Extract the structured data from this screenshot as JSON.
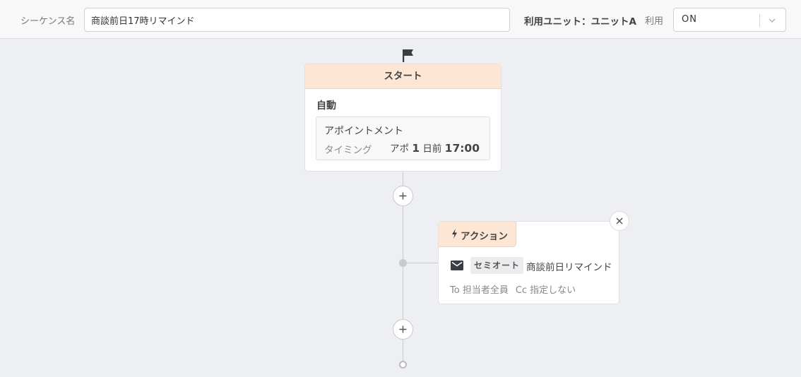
{
  "header": {
    "sequence_label": "シーケンス名",
    "sequence_name": "商談前日17時リマインド",
    "unit_text": "利用ユニット：ユニットA",
    "usage_label": "利用",
    "usage_value": "ON"
  },
  "start_node": {
    "header": "スタート",
    "mode": "自動",
    "trigger": {
      "title": "アポイントメント",
      "timing_label": "タイミング",
      "timing_prefix": "アポ",
      "timing_days": "1",
      "timing_days_unit": "日前",
      "timing_time": "17:00"
    }
  },
  "action_node": {
    "tab_label": "アクション",
    "sender": "セミオート",
    "template": "商談前日リマインド",
    "to": "To 担当者全員",
    "cc": "Cc 指定しない"
  },
  "icons": {
    "flag": "flag-icon",
    "add": "plus-icon",
    "action": "bolt-icon",
    "mail": "mail-icon",
    "remove": "close-icon",
    "dropdown": "chevron-down-icon"
  },
  "colors": {
    "canvas": "#eeeff3",
    "node_header": "#fde6d3",
    "connector": "#c9cace"
  }
}
